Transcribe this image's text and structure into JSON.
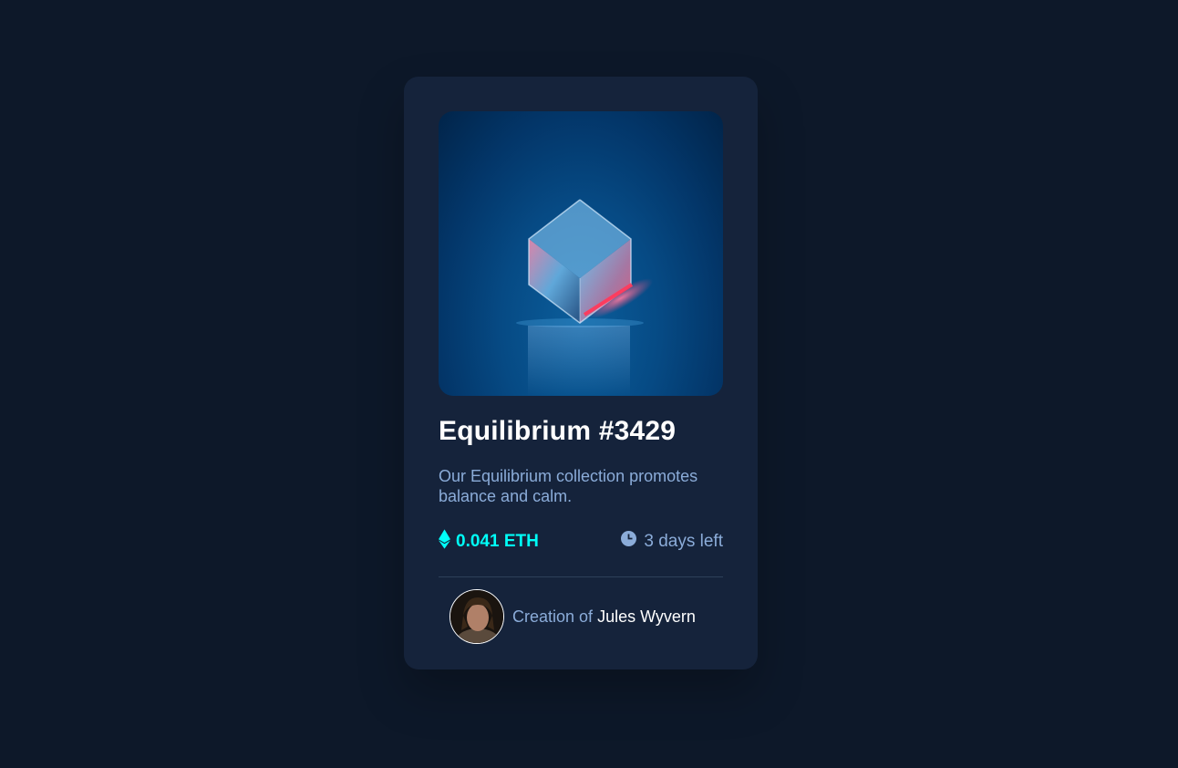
{
  "card": {
    "title": "Equilibrium #3429",
    "description": "Our Equilibrium collection promotes balance and calm.",
    "price": "0.041 ETH",
    "time_left": "3 days left",
    "creator_prefix": "Creation of",
    "creator_name": "Jules Wyvern"
  },
  "icons": {
    "price": "ethereum-icon",
    "time": "clock-icon"
  },
  "colors": {
    "background": "#0d1829",
    "card": "#15233b",
    "accent": "#00fff8",
    "muted_text": "#8bacd9",
    "divider": "#2e405a"
  }
}
